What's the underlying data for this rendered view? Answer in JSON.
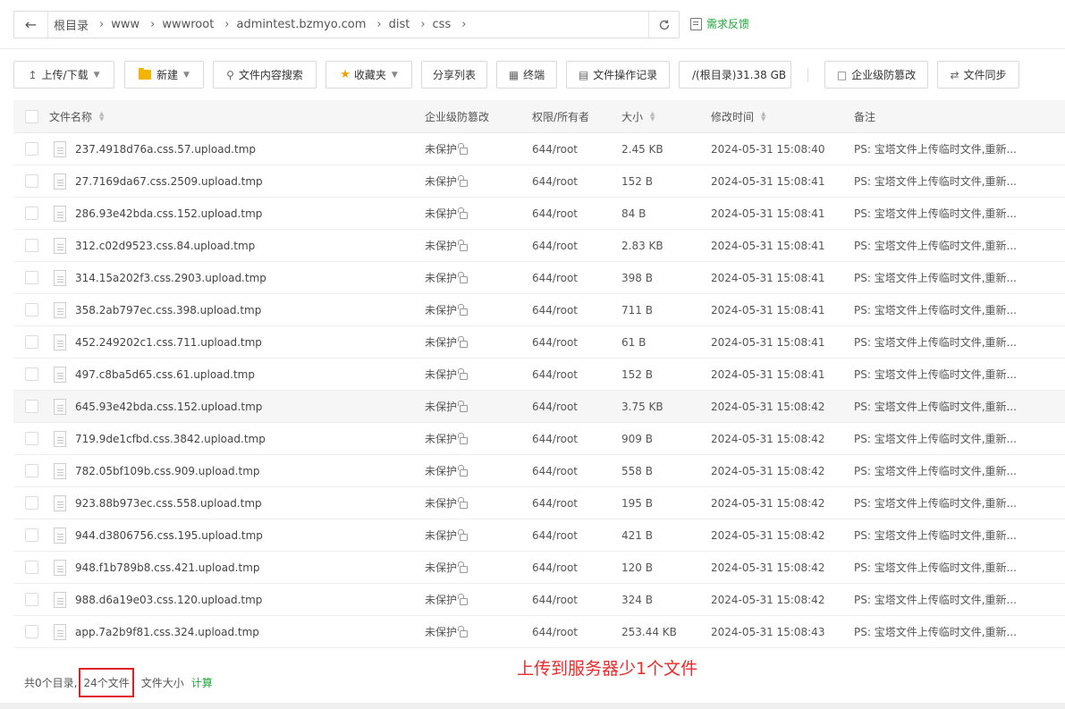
{
  "breadcrumb": [
    "根目录",
    "www",
    "wwwroot",
    "admintest.bzmyo.com",
    "dist",
    "css"
  ],
  "icons": {
    "back": "arrow-left-icon",
    "refresh": "refresh-icon",
    "feedback": "edit-note-icon"
  },
  "feedback_label": "需求反馈",
  "toolbar": {
    "upload": "上传/下载",
    "new": "新建",
    "search": "文件内容搜索",
    "favorites": "收藏夹",
    "share": "分享列表",
    "terminal": "终端",
    "oplog": "文件操作记录",
    "disk": "/(根目录)31.38 GB",
    "tamper": "企业级防篡改",
    "sync": "文件同步"
  },
  "columns": {
    "name": "文件名称",
    "protect": "企业级防篡改",
    "perm": "权限/所有者",
    "size": "大小",
    "mtime": "修改时间",
    "note": "备注"
  },
  "files": [
    {
      "name": "237.4918d76a.css.57.upload.tmp",
      "protect": "未保护",
      "perm": "644/root",
      "size": "2.45 KB",
      "mtime": "2024-05-31 15:08:40",
      "note": "PS: 宝塔文件上传临时文件,重新..."
    },
    {
      "name": "27.7169da67.css.2509.upload.tmp",
      "protect": "未保护",
      "perm": "644/root",
      "size": "152 B",
      "mtime": "2024-05-31 15:08:41",
      "note": "PS: 宝塔文件上传临时文件,重新..."
    },
    {
      "name": "286.93e42bda.css.152.upload.tmp",
      "protect": "未保护",
      "perm": "644/root",
      "size": "84 B",
      "mtime": "2024-05-31 15:08:41",
      "note": "PS: 宝塔文件上传临时文件,重新..."
    },
    {
      "name": "312.c02d9523.css.84.upload.tmp",
      "protect": "未保护",
      "perm": "644/root",
      "size": "2.83 KB",
      "mtime": "2024-05-31 15:08:41",
      "note": "PS: 宝塔文件上传临时文件,重新..."
    },
    {
      "name": "314.15a202f3.css.2903.upload.tmp",
      "protect": "未保护",
      "perm": "644/root",
      "size": "398 B",
      "mtime": "2024-05-31 15:08:41",
      "note": "PS: 宝塔文件上传临时文件,重新..."
    },
    {
      "name": "358.2ab797ec.css.398.upload.tmp",
      "protect": "未保护",
      "perm": "644/root",
      "size": "711 B",
      "mtime": "2024-05-31 15:08:41",
      "note": "PS: 宝塔文件上传临时文件,重新..."
    },
    {
      "name": "452.249202c1.css.711.upload.tmp",
      "protect": "未保护",
      "perm": "644/root",
      "size": "61 B",
      "mtime": "2024-05-31 15:08:41",
      "note": "PS: 宝塔文件上传临时文件,重新..."
    },
    {
      "name": "497.c8ba5d65.css.61.upload.tmp",
      "protect": "未保护",
      "perm": "644/root",
      "size": "152 B",
      "mtime": "2024-05-31 15:08:41",
      "note": "PS: 宝塔文件上传临时文件,重新..."
    },
    {
      "name": "645.93e42bda.css.152.upload.tmp",
      "protect": "未保护",
      "perm": "644/root",
      "size": "3.75 KB",
      "mtime": "2024-05-31 15:08:42",
      "note": "PS: 宝塔文件上传临时文件,重新..."
    },
    {
      "name": "719.9de1cfbd.css.3842.upload.tmp",
      "protect": "未保护",
      "perm": "644/root",
      "size": "909 B",
      "mtime": "2024-05-31 15:08:42",
      "note": "PS: 宝塔文件上传临时文件,重新..."
    },
    {
      "name": "782.05bf109b.css.909.upload.tmp",
      "protect": "未保护",
      "perm": "644/root",
      "size": "558 B",
      "mtime": "2024-05-31 15:08:42",
      "note": "PS: 宝塔文件上传临时文件,重新..."
    },
    {
      "name": "923.88b973ec.css.558.upload.tmp",
      "protect": "未保护",
      "perm": "644/root",
      "size": "195 B",
      "mtime": "2024-05-31 15:08:42",
      "note": "PS: 宝塔文件上传临时文件,重新..."
    },
    {
      "name": "944.d3806756.css.195.upload.tmp",
      "protect": "未保护",
      "perm": "644/root",
      "size": "421 B",
      "mtime": "2024-05-31 15:08:42",
      "note": "PS: 宝塔文件上传临时文件,重新..."
    },
    {
      "name": "948.f1b789b8.css.421.upload.tmp",
      "protect": "未保护",
      "perm": "644/root",
      "size": "120 B",
      "mtime": "2024-05-31 15:08:42",
      "note": "PS: 宝塔文件上传临时文件,重新..."
    },
    {
      "name": "988.d6a19e03.css.120.upload.tmp",
      "protect": "未保护",
      "perm": "644/root",
      "size": "324 B",
      "mtime": "2024-05-31 15:08:42",
      "note": "PS: 宝塔文件上传临时文件,重新..."
    },
    {
      "name": "app.7a2b9f81.css.324.upload.tmp",
      "protect": "未保护",
      "perm": "644/root",
      "size": "253.44 KB",
      "mtime": "2024-05-31 15:08:43",
      "note": "PS: 宝塔文件上传临时文件,重新..."
    }
  ],
  "highlight_row": 8,
  "footer": {
    "dirs": "共0个目录,",
    "files": "24个文件",
    "size_label": "文件大小",
    "calc": "计算"
  },
  "annotation": "上传到服务器少1个文件",
  "colors": {
    "accent_green": "#20a53a",
    "annotation_red": "#ea2b2b",
    "folder_yellow": "#f5b400"
  }
}
